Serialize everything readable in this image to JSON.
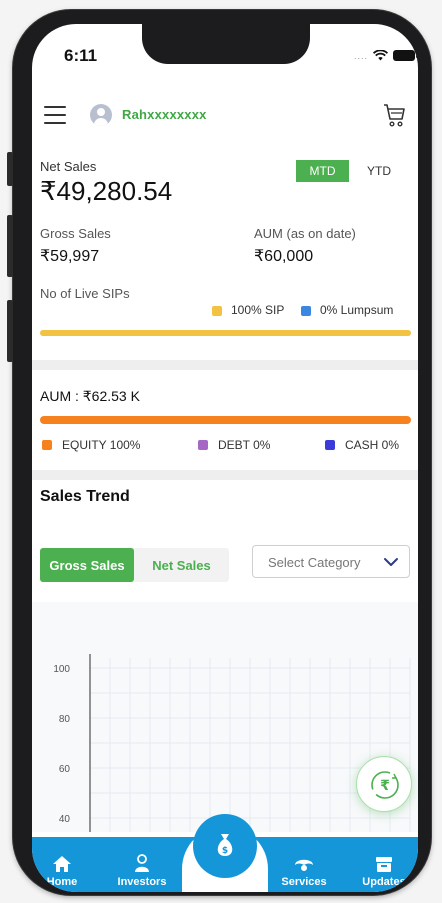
{
  "status_bar": {
    "time": "6:11",
    "signal": "...."
  },
  "header": {
    "user_name": "Rahxxxxxxxx"
  },
  "sales": {
    "net_sales_label": "Net Sales",
    "net_sales_value": "₹49,280.54",
    "period_toggle": [
      {
        "label": "MTD",
        "active": true
      },
      {
        "label": "YTD",
        "active": false
      }
    ],
    "gross_sales_label": "Gross Sales",
    "gross_sales_value": "₹59,997",
    "aum_label": "AUM (as on date)",
    "aum_value": "₹60,000",
    "live_sips_label": "No of Live SIPs",
    "sip_legend": [
      {
        "label": "100% SIP",
        "color": "#f2c342",
        "percent": 100
      },
      {
        "label": "0% Lumpsum",
        "color": "#3a86e0",
        "percent": 0
      }
    ]
  },
  "aum": {
    "title": "AUM : ₹62.53 K",
    "legend": [
      {
        "label": "EQUITY 100%",
        "color": "#f5821f",
        "percent": 100
      },
      {
        "label": "DEBT 0%",
        "color": "#a566c4",
        "percent": 0
      },
      {
        "label": "CASH 0%",
        "color": "#3b3bd9",
        "percent": 0
      }
    ]
  },
  "sales_trend": {
    "title": "Sales Trend",
    "tabs": [
      {
        "label": "Gross Sales",
        "active": true
      },
      {
        "label": "Net Sales",
        "active": false
      }
    ],
    "category_placeholder": "Select Category"
  },
  "chart_data": {
    "type": "line",
    "xlabel": "",
    "ylabel": "",
    "ylim": [
      40,
      100
    ],
    "y_ticks": [
      100,
      80,
      60,
      40
    ],
    "series": [],
    "grid": true
  },
  "bottom_nav": {
    "items": [
      {
        "label": "Home",
        "icon": "home-icon"
      },
      {
        "label": "Investors",
        "icon": "investors-icon"
      },
      {
        "label": "Services",
        "icon": "services-icon"
      },
      {
        "label": "Updates",
        "icon": "updates-icon"
      }
    ],
    "center_icon": "money-bag-icon"
  },
  "colors": {
    "accent_green": "#4caf50",
    "nav_blue": "#1596d8",
    "sip_bar": "#f2c342",
    "aum_bar": "#f5821f"
  }
}
